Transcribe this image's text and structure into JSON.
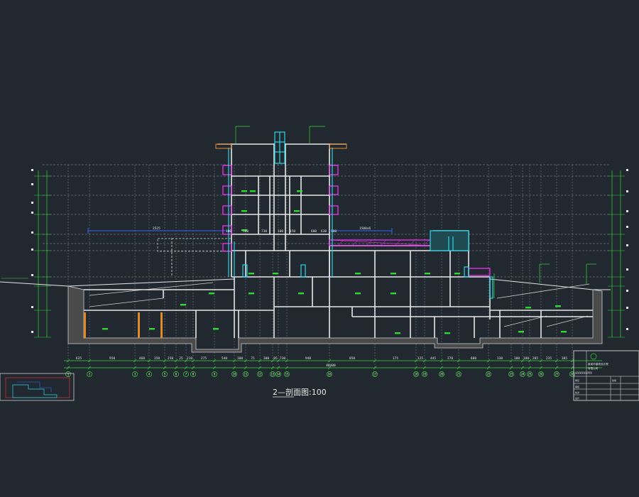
{
  "drawing": {
    "title_prefix": "2-",
    "title_main": "2—剖面图",
    "scale": "1:100",
    "title_full": "2—剖面图:100",
    "total_span": "80400"
  },
  "beam_labels": {
    "left": "2525",
    "right": "1500x6"
  },
  "room_dims": [
    "100",
    "580",
    "730",
    "100",
    "150",
    "600",
    "630",
    "100"
  ],
  "bottom_dimensions": [
    "625",
    "950",
    "460",
    "150",
    "250",
    "25",
    "210",
    "275",
    "540",
    "100",
    "75",
    "300",
    "85",
    "730",
    "940",
    "850",
    "175",
    "125",
    "445",
    "270",
    "600",
    "130",
    "100",
    "180",
    "205",
    "235",
    "385"
  ],
  "axis_labels": [
    "1",
    "2",
    "3",
    "4",
    "5",
    "6",
    "7",
    "8",
    "9",
    "10",
    "11",
    "12",
    "13",
    "14",
    "15",
    "16",
    "17",
    "18",
    "19",
    "20",
    "21",
    "22",
    "23",
    "24",
    "25",
    "26",
    "27",
    "28"
  ],
  "title_block": {
    "company_line1": "某某市建筑设计院",
    "company_line2": "有限公司",
    "rows": [
      "审定",
      "审核",
      "校对",
      "设计",
      "制图"
    ],
    "project": "某某某某某某项目",
    "sheet": "建施"
  },
  "colors": {
    "background": "#212830",
    "wall": "#e6e6e6",
    "grid": "#8a8f96",
    "dim": "#33d633",
    "magenta": "#ff33ff",
    "cyan": "#29d6e6",
    "blue": "#3366ff",
    "orange": "#e08a2a"
  }
}
